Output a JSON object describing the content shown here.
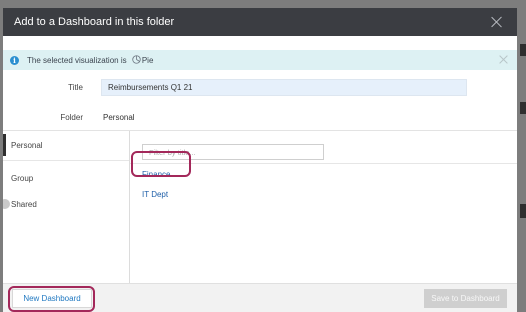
{
  "dialog": {
    "title": "Add to a Dashboard in this folder"
  },
  "info": {
    "text_prefix": "The selected visualization is",
    "viz_name": "Pie"
  },
  "form": {
    "title_label": "Title",
    "title_value": "Reimbursements Q1 21",
    "folder_label": "Folder",
    "folder_value": "Personal"
  },
  "nav": {
    "items": [
      {
        "label": "Personal",
        "active": true
      },
      {
        "label": "Group"
      },
      {
        "label": "Shared"
      }
    ]
  },
  "filter": {
    "placeholder": "Filter by title..."
  },
  "folders": [
    {
      "label": "Finance",
      "highlighted": true
    },
    {
      "label": "IT Dept"
    }
  ],
  "footer": {
    "new_dashboard_label": "New Dashboard",
    "save_label": "Save to Dashboard"
  },
  "colors": {
    "titlebar": "#3b3d42",
    "info_bar": "#ddf1f3",
    "link": "#1f5fa8",
    "highlight": "#a3285a"
  }
}
